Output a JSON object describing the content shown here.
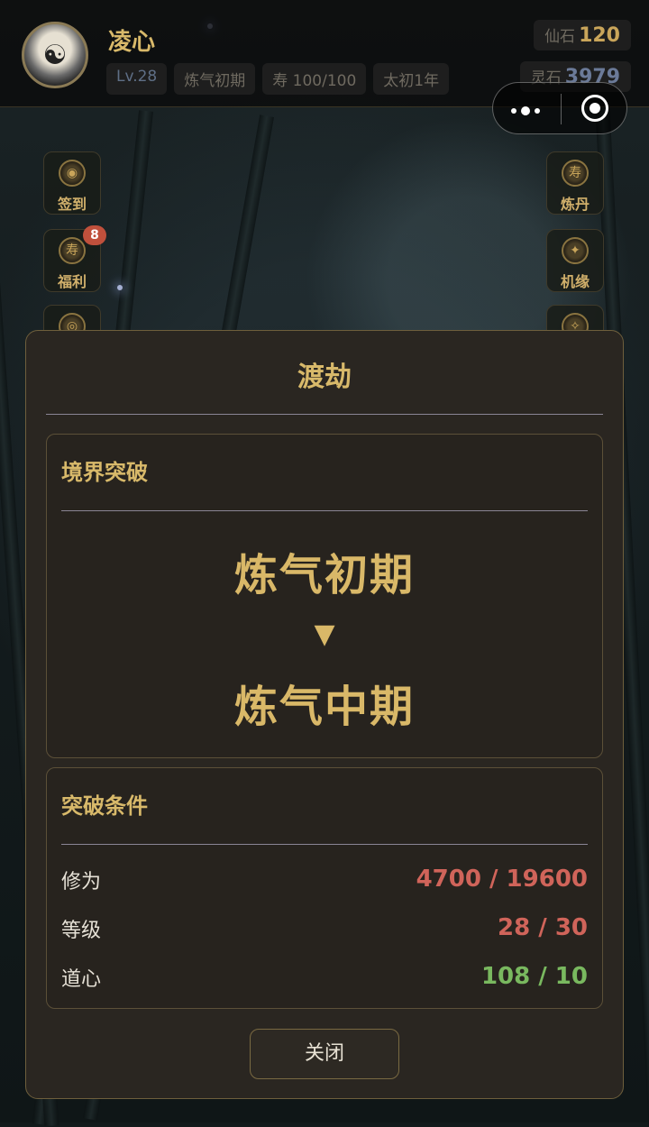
{
  "player": {
    "name": "凌心",
    "level": "Lv.28",
    "realm": "炼气初期",
    "lifespan": "寿 100/100",
    "era": "太初1年"
  },
  "currencies": {
    "xianshi_label": "仙石",
    "xianshi_value": "120",
    "lingshi_label": "灵石",
    "lingshi_value": "3979"
  },
  "side_left": [
    {
      "label": "签到"
    },
    {
      "label": "福利",
      "badge": "8"
    }
  ],
  "side_right": [
    {
      "label": "炼丹"
    },
    {
      "label": "机缘"
    }
  ],
  "modal": {
    "title": "渡劫",
    "breakthrough": {
      "title": "境界突破",
      "from": "炼气初期",
      "arrow": "▼",
      "to": "炼气中期"
    },
    "conditions": {
      "title": "突破条件",
      "rows": [
        {
          "label": "修为",
          "value": "4700 / 19600",
          "status": "unmet"
        },
        {
          "label": "等级",
          "value": "28 / 30",
          "status": "unmet"
        },
        {
          "label": "道心",
          "value": "108 / 10",
          "status": "met"
        }
      ]
    },
    "close_label": "关闭"
  },
  "colors": {
    "gold": "#d8b96a",
    "unmet": "#d0645a",
    "met": "#79b85f"
  }
}
